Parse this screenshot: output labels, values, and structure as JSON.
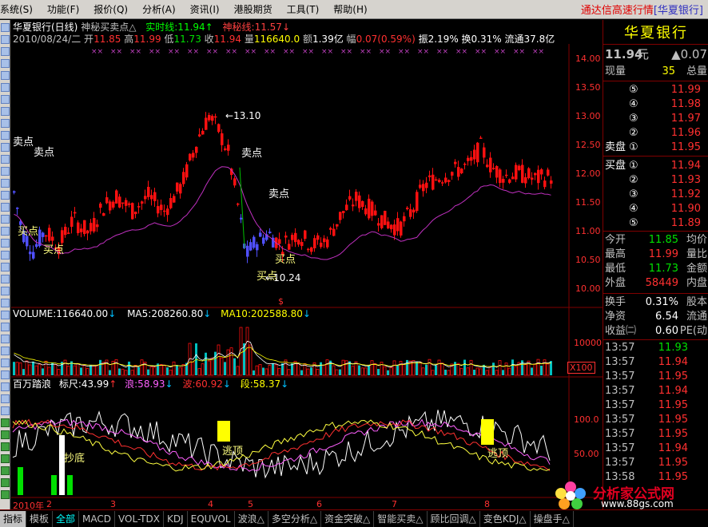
{
  "menu": {
    "items": [
      "系统(S)",
      "功能(F)",
      "报价(Q)",
      "分析(A)",
      "资讯(I)",
      "港股期货",
      "工具(T)",
      "帮助(H)"
    ],
    "app_title": "通达信高速行情",
    "app_sub": "[华夏银行]"
  },
  "chart_header": {
    "stock": "华夏银行(日线)",
    "indicator": "神秘买卖点△",
    "realtime": "实时线:11.94↑",
    "mystery": "神秘线:11.57↓"
  },
  "ohlc": {
    "date": "2010/08/24/二",
    "open_lbl": "开",
    "open": "11.85",
    "high_lbl": "高",
    "high": "11.99",
    "low_lbl": "低",
    "low": "11.73",
    "close_lbl": "收",
    "close": "11.94",
    "vol_lbl": "量",
    "vol": "116640.0",
    "amt_lbl": "额",
    "amt": "1.39亿",
    "chg_lbl": "幅",
    "chg": "0.07(0.59%)",
    "amp": "振2.19%",
    "turn": "换0.31%",
    "float": "流通37.8亿"
  },
  "price_axis": [
    "14.00",
    "13.50",
    "13.00",
    "12.50",
    "12.00",
    "11.50",
    "11.00",
    "10.50",
    "10.00"
  ],
  "annotations": {
    "sell1": "卖点",
    "sell2": "卖点",
    "sell3": "卖点",
    "sell4": "卖点",
    "buy1": "买点",
    "buy2": "买点",
    "buy3": "买点",
    "buy4": "买点",
    "high_mark": "13.10",
    "low_mark": "10.24"
  },
  "volume_pane": {
    "label": "VOLUME:116640.00",
    "ma5": "MA5:208260.80",
    "ma10": "MA10:202588.80",
    "arrow": "↓",
    "axis_top": "10000",
    "axis_unit": "X100"
  },
  "wave_pane": {
    "name": "百万踏浪",
    "ruler": "标尺:43.99",
    "ruler_arrow": "↑",
    "lang": "浪:58.93",
    "bo": "波:60.92",
    "duan": "段:58.37",
    "arrow": "↓",
    "axis_100": "100.0",
    "axis_50": "50.00",
    "bottom_sign": "抄底",
    "top_sign1": "逃顶",
    "top_sign2": "逃顶"
  },
  "dates": [
    "2010年",
    "2",
    "3",
    "4",
    "5",
    "6",
    "7",
    "8"
  ],
  "quote": {
    "name": "华夏银行",
    "price": "11.94",
    "price_unit": "元",
    "change": "▲0.07",
    "now_vol_lbl": "现量",
    "now_vol": "35",
    "total_vol_lbl": "总量",
    "asks": [
      {
        "lbl": "⑤",
        "price": "11.99"
      },
      {
        "lbl": "④",
        "price": "11.98"
      },
      {
        "lbl": "③",
        "price": "11.97"
      },
      {
        "lbl": "②",
        "price": "11.96"
      },
      {
        "lbl": "①",
        "price": "11.95"
      }
    ],
    "ask_lbl": "卖盘",
    "bid_lbl": "买盘",
    "bids": [
      {
        "lbl": "①",
        "price": "11.94"
      },
      {
        "lbl": "②",
        "price": "11.93"
      },
      {
        "lbl": "③",
        "price": "11.92"
      },
      {
        "lbl": "④",
        "price": "11.90"
      },
      {
        "lbl": "⑤",
        "price": "11.89"
      }
    ],
    "stats": [
      {
        "l": "今开",
        "v": "11.85",
        "r": "均价",
        "c": "green"
      },
      {
        "l": "最高",
        "v": "11.99",
        "r": "量比",
        "c": "red"
      },
      {
        "l": "最低",
        "v": "11.73",
        "r": "金额",
        "c": "green"
      },
      {
        "l": "外盘",
        "v": "58449",
        "r": "内盘",
        "c": "red"
      }
    ],
    "stats2": [
      {
        "l": "换手",
        "v": "0.31%",
        "r": "股本"
      },
      {
        "l": "净资",
        "v": "6.54",
        "r": "流通"
      },
      {
        "l": "收益㈡",
        "v": "0.60",
        "r": "PE(动"
      }
    ],
    "ticks": [
      {
        "t": "13:57",
        "p": "11.93"
      },
      {
        "t": "13:57",
        "p": "11.94"
      },
      {
        "t": "13:57",
        "p": "11.95"
      },
      {
        "t": "13:57",
        "p": "11.94"
      },
      {
        "t": "13:57",
        "p": "11.95"
      },
      {
        "t": "13:57",
        "p": "11.95"
      },
      {
        "t": "13:57",
        "p": "11.95"
      },
      {
        "t": "13:57",
        "p": "11.94"
      },
      {
        "t": "13:57",
        "p": "11.95"
      },
      {
        "t": "13:58",
        "p": "11.95"
      }
    ]
  },
  "bottom_tabs": [
    "指标",
    "模板",
    "全部",
    "MACD",
    "VOL-TDX",
    "KDJ",
    "EQUVOL",
    "波浪△",
    "多空分析△",
    "资金突破△",
    "智能买卖△",
    "顾比回调△",
    "变色KDJ△",
    "操盘手△"
  ],
  "logo": {
    "site": "分析家公式网",
    "url": "www.88gs.com"
  }
}
